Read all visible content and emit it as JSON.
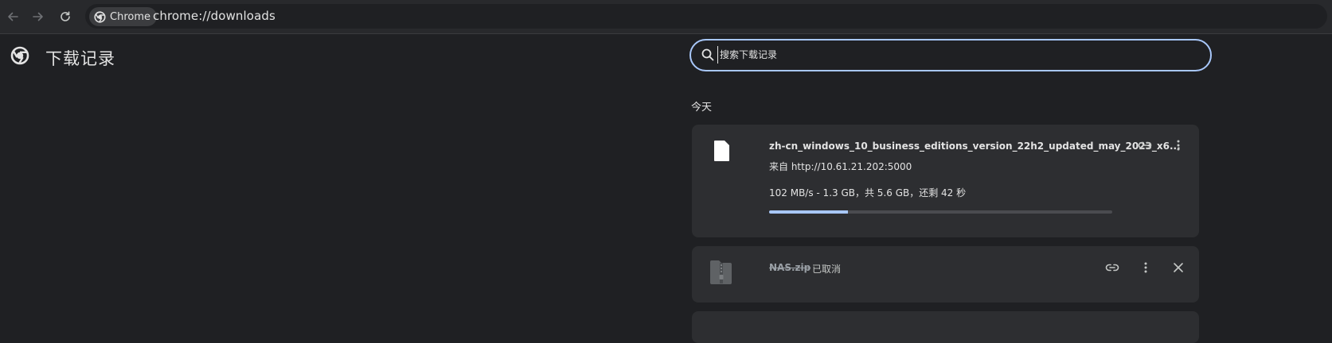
{
  "toolbar": {
    "back_icon": "arrow-left-icon",
    "forward_icon": "arrow-right-icon",
    "reload_icon": "reload-icon",
    "chip_label": "Chrome",
    "url": "chrome://downloads"
  },
  "page": {
    "title": "下载记录",
    "logo_icon": "chrome-logo-icon"
  },
  "search": {
    "placeholder": "搜索下载记录",
    "value": ""
  },
  "downloads": {
    "date_header": "今天",
    "items": [
      {
        "name": "zh-cn_windows_10_business_editions_version_22h2_updated_may_2023_x6...",
        "source": "来自 http://10.61.21.202:5000",
        "status": "102 MB/s - 1.3 GB，共 5.6 GB，还剩 42 秒",
        "progress": 0.23,
        "icon": "file-icon"
      },
      {
        "name": "NAS.zip",
        "status": "已取消",
        "icon": "zip-archive-icon"
      }
    ]
  },
  "colors": {
    "background": "#1f2023",
    "card": "#2d2e31",
    "accent": "#a8c7fa"
  }
}
